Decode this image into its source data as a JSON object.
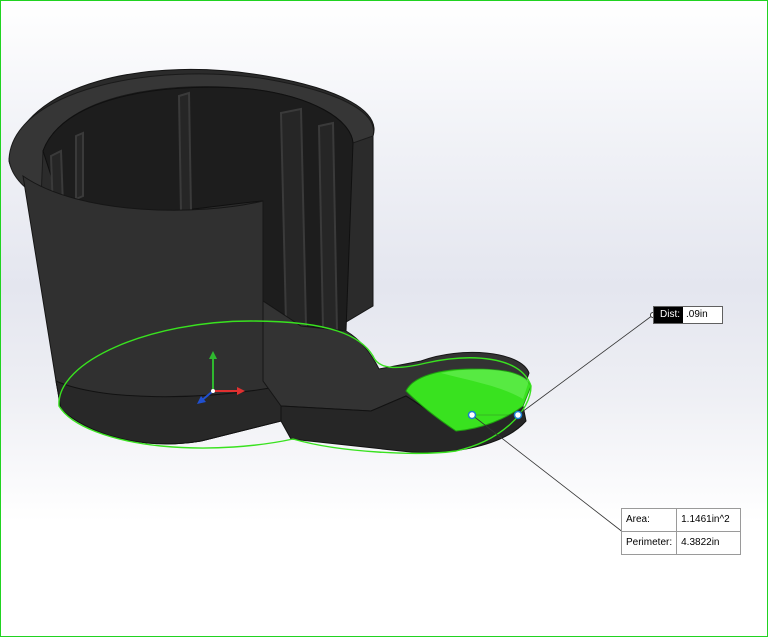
{
  "viewport": {
    "border_color": "#21d321",
    "selection_color": "#39e21f",
    "model_color": "#2b2b2b"
  },
  "triad": {
    "icon": "coordinate-triad-icon",
    "axes": [
      {
        "name": "x",
        "color": "#e03030"
      },
      {
        "name": "y",
        "color": "#2fb82f"
      },
      {
        "name": "z",
        "color": "#2050d0"
      }
    ]
  },
  "dist_callout": {
    "label": "Dist:",
    "value": ".09in"
  },
  "measure_callout": {
    "rows": [
      {
        "label": "Area:",
        "value": "1.1461in^2"
      },
      {
        "label": "Perimeter:",
        "value": "4.3822in"
      }
    ]
  }
}
